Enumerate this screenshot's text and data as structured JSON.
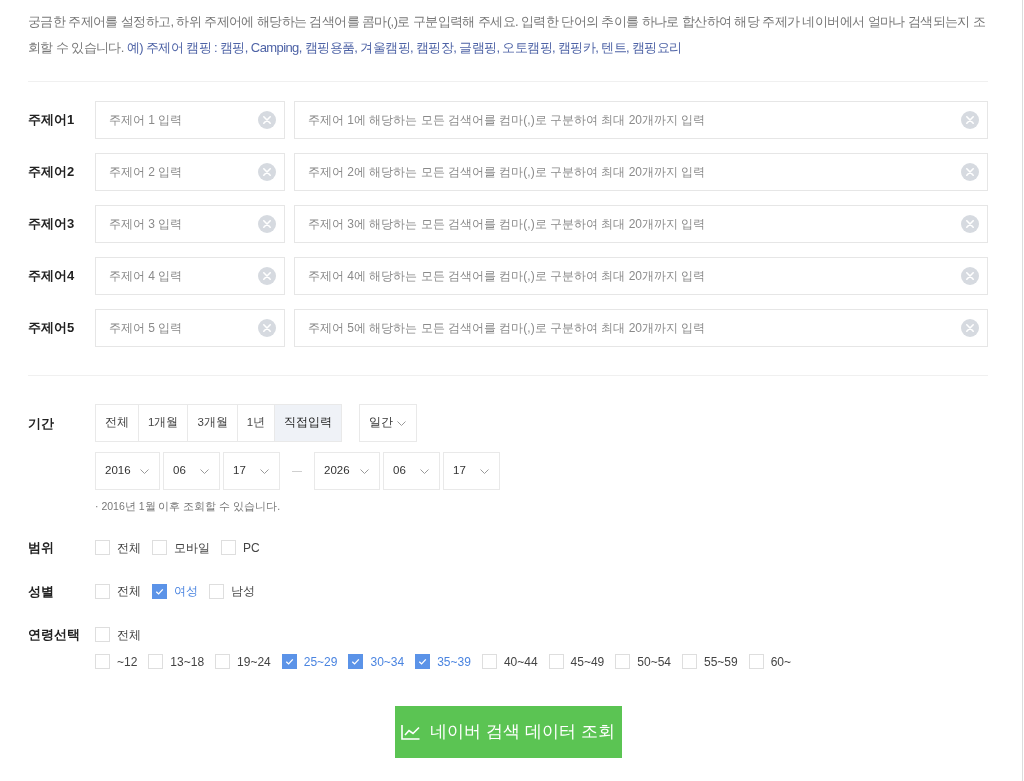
{
  "intro": {
    "text": "궁금한 주제어를 설정하고, 하위 주제어에 해당하는 검색어를 콤마(,)로 구분입력해 주세요. 입력한 단어의 추이를 하나로 합산하여 해당 주제가 네이버에서 얼마나 검색되는지 조회할 수 있습니다.",
    "example": "예) 주제어 캠핑 : 캠핑, Camping, 캠핑용품, 겨울캠핑, 캠핑장, 글램핑, 오토캠핑, 캠핑카, 텐트, 캠핑요리"
  },
  "topics": [
    {
      "label": "주제어1",
      "topic_field": {
        "placeholder": "주제어 1 입력"
      },
      "keywords_field": {
        "placeholder": "주제어 1에 해당하는 모든 검색어를 컴마(,)로 구분하여 최대 20개까지 입력"
      }
    },
    {
      "label": "주제어2",
      "topic_field": {
        "placeholder": "주제어 2 입력"
      },
      "keywords_field": {
        "placeholder": "주제어 2에 해당하는 모든 검색어를 컴마(,)로 구분하여 최대 20개까지 입력"
      }
    },
    {
      "label": "주제어3",
      "topic_field": {
        "placeholder": "주제어 3 입력"
      },
      "keywords_field": {
        "placeholder": "주제어 3에 해당하는 모든 검색어를 컴마(,)로 구분하여 최대 20개까지 입력"
      }
    },
    {
      "label": "주제어4",
      "topic_field": {
        "placeholder": "주제어 4 입력"
      },
      "keywords_field": {
        "placeholder": "주제어 4에 해당하는 모든 검색어를 컴마(,)로 구분하여 최대 20개까지 입력"
      }
    },
    {
      "label": "주제어5",
      "topic_field": {
        "placeholder": "주제어 5 입력"
      },
      "keywords_field": {
        "placeholder": "주제어 5에 해당하는 모든 검색어를 컴마(,)로 구분하여 최대 20개까지 입력"
      }
    }
  ],
  "period": {
    "label": "기간",
    "tabs": [
      {
        "label": "전체",
        "selected": false
      },
      {
        "label": "1개월",
        "selected": false
      },
      {
        "label": "3개월",
        "selected": false
      },
      {
        "label": "1년",
        "selected": false
      },
      {
        "label": "직접입력",
        "selected": true
      }
    ],
    "interval": {
      "value": "일간"
    },
    "start": [
      {
        "value": "2016"
      },
      {
        "value": "06"
      },
      {
        "value": "17"
      }
    ],
    "end": [
      {
        "value": "2026"
      },
      {
        "value": "06"
      },
      {
        "value": "17"
      }
    ],
    "note": "· 2016년 1월 이후 조회할 수 있습니다."
  },
  "scope": {
    "label": "범위",
    "options": [
      {
        "label": "전체",
        "checked": false
      },
      {
        "label": "모바일",
        "checked": false
      },
      {
        "label": "PC",
        "checked": false
      }
    ]
  },
  "gender": {
    "label": "성별",
    "options": [
      {
        "label": "전체",
        "checked": false
      },
      {
        "label": "여성",
        "checked": true
      },
      {
        "label": "남성",
        "checked": false
      }
    ]
  },
  "age": {
    "label": "연령선택",
    "all": {
      "label": "전체",
      "checked": false
    },
    "options": [
      {
        "label": "~12",
        "checked": false
      },
      {
        "label": "13~18",
        "checked": false
      },
      {
        "label": "19~24",
        "checked": false
      },
      {
        "label": "25~29",
        "checked": true
      },
      {
        "label": "30~34",
        "checked": true
      },
      {
        "label": "35~39",
        "checked": true
      },
      {
        "label": "40~44",
        "checked": false
      },
      {
        "label": "45~49",
        "checked": false
      },
      {
        "label": "50~54",
        "checked": false
      },
      {
        "label": "55~59",
        "checked": false
      },
      {
        "label": "60~",
        "checked": false
      }
    ]
  },
  "submit_button": {
    "label": "네이버 검색 데이터 조회"
  }
}
